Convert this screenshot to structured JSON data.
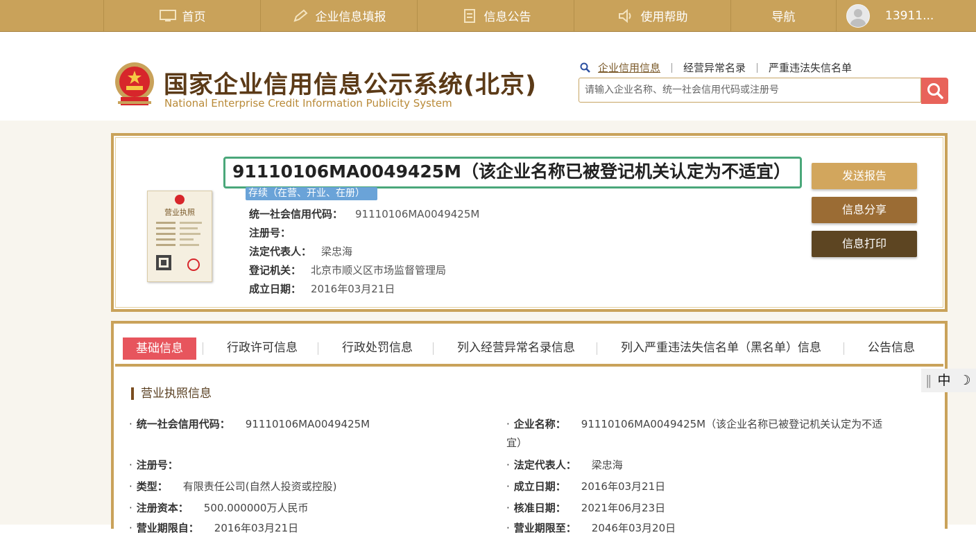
{
  "nav": {
    "items": [
      {
        "label": "首页",
        "icon": "monitor-icon"
      },
      {
        "label": "企业信息填报",
        "icon": "edit-icon"
      },
      {
        "label": "信息公告",
        "icon": "document-icon"
      },
      {
        "label": "使用帮助",
        "icon": "speaker-icon"
      },
      {
        "label": "导航",
        "icon": ""
      }
    ],
    "user": "13911..."
  },
  "header": {
    "title": "国家企业信用信息公示系统(北京)",
    "subtitle": "National Enterprise Credit Information Publicity System",
    "search_tabs": [
      "企业信用信息",
      "经营异常名录",
      "严重违法失信名单"
    ],
    "search_placeholder": "请输入企业名称、统一社会信用代码或注册号"
  },
  "company": {
    "name": "91110106MA0049425M（该企业名称已被登记机关认定为不适宜）",
    "status": "存续（在营、开业、在册）",
    "rows": [
      {
        "label": "统一社会信用代码：",
        "value": "91110106MA0049425M"
      },
      {
        "label": "注册号：",
        "value": ""
      },
      {
        "label": "法定代表人：",
        "value": "梁忠海"
      },
      {
        "label": "登记机关：",
        "value": "北京市顺义区市场监督管理局"
      },
      {
        "label": "成立日期：",
        "value": "2016年03月21日"
      }
    ],
    "license_title": "营业执照",
    "buttons": {
      "send": "发送报告",
      "share": "信息分享",
      "print": "信息打印"
    }
  },
  "tabs": [
    "基础信息",
    "行政许可信息",
    "行政处罚信息",
    "列入经营异常名录信息",
    "列入严重违法失信名单（黑名单）信息",
    "公告信息"
  ],
  "license_section": {
    "title": "营业执照信息",
    "left": [
      {
        "label": "统一社会信用代码：",
        "value": "91110106MA0049425M"
      },
      {
        "label": "注册号：",
        "value": ""
      },
      {
        "label": "类型：",
        "value": "有限责任公司(自然人投资或控股)"
      },
      {
        "label": "注册资本：",
        "value": "500.000000万人民币"
      },
      {
        "label": "营业期限自：",
        "value": "2016年03月21日"
      }
    ],
    "right": [
      {
        "label": "企业名称：",
        "value": "91110106MA0049425M（该企业名称已被登记机关认定为不适",
        "value2": "宜）"
      },
      {
        "label": "法定代表人：",
        "value": "梁忠海"
      },
      {
        "label": "成立日期：",
        "value": "2016年03月21日"
      },
      {
        "label": "核准日期：",
        "value": "2021年06月23日"
      },
      {
        "label": "营业期限至：",
        "value": "2046年03月20日"
      }
    ]
  },
  "ime": {
    "label": "中",
    "moon": "☽"
  },
  "colors": {
    "gold": "#c9a25a",
    "brown": "#5b3a17",
    "red": "#e7555d",
    "green": "#4aa77a"
  }
}
